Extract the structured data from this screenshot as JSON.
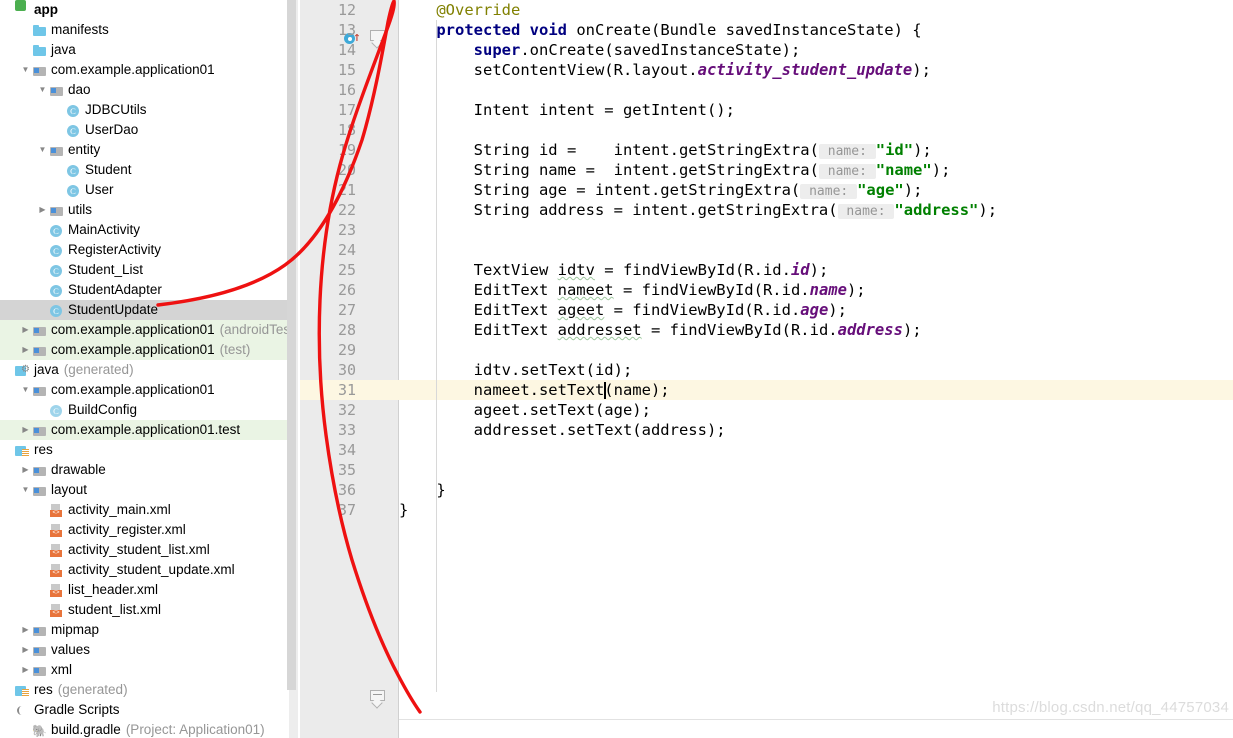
{
  "project_tree": {
    "title": "app",
    "items": [
      {
        "label": "app",
        "indent": 0,
        "arrow": "",
        "icon": "module-app-icon",
        "bold": true,
        "suffix": "",
        "state": "normal"
      },
      {
        "label": "manifests",
        "indent": 1,
        "arrow": "",
        "icon": "folder-icon",
        "suffix": "",
        "state": "normal"
      },
      {
        "label": "java",
        "indent": 1,
        "arrow": "",
        "icon": "folder-icon",
        "suffix": "",
        "state": "normal"
      },
      {
        "label": "com.example.application01",
        "indent": 1,
        "arrow": "down",
        "icon": "package-icon",
        "suffix": "",
        "state": "normal"
      },
      {
        "label": "dao",
        "indent": 2,
        "arrow": "down",
        "icon": "package-icon",
        "suffix": "",
        "state": "normal"
      },
      {
        "label": "JDBCUtils",
        "indent": 3,
        "arrow": "",
        "icon": "java-class-icon",
        "suffix": "",
        "state": "normal"
      },
      {
        "label": "UserDao",
        "indent": 3,
        "arrow": "",
        "icon": "java-class-icon",
        "suffix": "",
        "state": "normal"
      },
      {
        "label": "entity",
        "indent": 2,
        "arrow": "down",
        "icon": "package-icon",
        "suffix": "",
        "state": "normal"
      },
      {
        "label": "Student",
        "indent": 3,
        "arrow": "",
        "icon": "java-class-icon",
        "suffix": "",
        "state": "normal"
      },
      {
        "label": "User",
        "indent": 3,
        "arrow": "",
        "icon": "java-class-icon",
        "suffix": "",
        "state": "normal"
      },
      {
        "label": "utils",
        "indent": 2,
        "arrow": "right",
        "icon": "package-icon",
        "suffix": "",
        "state": "normal"
      },
      {
        "label": "MainActivity",
        "indent": 2,
        "arrow": "",
        "icon": "java-class-icon",
        "suffix": "",
        "state": "normal"
      },
      {
        "label": "RegisterActivity",
        "indent": 2,
        "arrow": "",
        "icon": "java-class-icon",
        "suffix": "",
        "state": "normal"
      },
      {
        "label": "Student_List",
        "indent": 2,
        "arrow": "",
        "icon": "java-class-icon",
        "suffix": "",
        "state": "normal"
      },
      {
        "label": "StudentAdapter",
        "indent": 2,
        "arrow": "",
        "icon": "java-class-icon",
        "suffix": "",
        "state": "normal"
      },
      {
        "label": "StudentUpdate",
        "indent": 2,
        "arrow": "",
        "icon": "java-class-icon",
        "suffix": "",
        "state": "selected"
      },
      {
        "label": "com.example.application01",
        "indent": 1,
        "arrow": "right",
        "icon": "package-icon",
        "suffix": "(androidTest)",
        "state": "green"
      },
      {
        "label": "com.example.application01",
        "indent": 1,
        "arrow": "right",
        "icon": "package-icon",
        "suffix": "(test)",
        "state": "green"
      },
      {
        "label": "java",
        "indent": 0,
        "arrow": "",
        "icon": "java-generated-icon",
        "suffix": "(generated)",
        "state": "normal"
      },
      {
        "label": "com.example.application01",
        "indent": 1,
        "arrow": "down",
        "icon": "package-icon",
        "suffix": "",
        "state": "normal"
      },
      {
        "label": "BuildConfig",
        "indent": 2,
        "arrow": "",
        "icon": "java-class-generated-icon",
        "suffix": "",
        "state": "normal"
      },
      {
        "label": "com.example.application01.test",
        "indent": 1,
        "arrow": "right",
        "icon": "package-icon",
        "suffix": "",
        "state": "green"
      },
      {
        "label": "res",
        "indent": 0,
        "arrow": "",
        "icon": "res-folder-icon",
        "suffix": "",
        "state": "normal"
      },
      {
        "label": "drawable",
        "indent": 1,
        "arrow": "right",
        "icon": "package-icon",
        "suffix": "",
        "state": "normal"
      },
      {
        "label": "layout",
        "indent": 1,
        "arrow": "down",
        "icon": "package-icon",
        "suffix": "",
        "state": "normal"
      },
      {
        "label": "activity_main.xml",
        "indent": 2,
        "arrow": "",
        "icon": "xml-layout-icon",
        "suffix": "",
        "state": "normal"
      },
      {
        "label": "activity_register.xml",
        "indent": 2,
        "arrow": "",
        "icon": "xml-layout-icon",
        "suffix": "",
        "state": "normal"
      },
      {
        "label": "activity_student_list.xml",
        "indent": 2,
        "arrow": "",
        "icon": "xml-layout-icon",
        "suffix": "",
        "state": "normal"
      },
      {
        "label": "activity_student_update.xml",
        "indent": 2,
        "arrow": "",
        "icon": "xml-layout-icon",
        "suffix": "",
        "state": "normal"
      },
      {
        "label": "list_header.xml",
        "indent": 2,
        "arrow": "",
        "icon": "xml-layout-icon",
        "suffix": "",
        "state": "normal"
      },
      {
        "label": "student_list.xml",
        "indent": 2,
        "arrow": "",
        "icon": "xml-layout-icon",
        "suffix": "",
        "state": "normal"
      },
      {
        "label": "mipmap",
        "indent": 1,
        "arrow": "right",
        "icon": "package-icon",
        "suffix": "",
        "state": "normal"
      },
      {
        "label": "values",
        "indent": 1,
        "arrow": "right",
        "icon": "package-icon",
        "suffix": "",
        "state": "normal"
      },
      {
        "label": "xml",
        "indent": 1,
        "arrow": "right",
        "icon": "package-icon",
        "suffix": "",
        "state": "normal"
      },
      {
        "label": "res",
        "indent": 0,
        "arrow": "",
        "icon": "res-folder-icon",
        "suffix": "(generated)",
        "state": "normal"
      },
      {
        "label": "Gradle Scripts",
        "indent": 0,
        "arrow": "",
        "icon": "gradle-scripts-icon",
        "suffix": "",
        "state": "normal"
      },
      {
        "label": "build.gradle",
        "indent": 1,
        "arrow": "",
        "icon": "gradle-file-icon",
        "suffix": "(Project: Application01)",
        "state": "normal"
      }
    ]
  },
  "editor": {
    "first_line_number": 12,
    "highlighted_line": 31,
    "override_marker_line": 13,
    "lines": [
      {
        "n": 12,
        "tokens": [
          {
            "t": "    ",
            "c": ""
          },
          {
            "t": "@Override",
            "c": "anno"
          }
        ]
      },
      {
        "n": 13,
        "tokens": [
          {
            "t": "    ",
            "c": ""
          },
          {
            "t": "protected",
            "c": "kw"
          },
          {
            "t": " ",
            "c": ""
          },
          {
            "t": "void",
            "c": "kw"
          },
          {
            "t": " onCreate(Bundle savedInstanceState) {",
            "c": ""
          }
        ]
      },
      {
        "n": 14,
        "tokens": [
          {
            "t": "        ",
            "c": ""
          },
          {
            "t": "super",
            "c": "kw"
          },
          {
            "t": ".onCreate(savedInstanceState);",
            "c": ""
          }
        ]
      },
      {
        "n": 15,
        "tokens": [
          {
            "t": "        setContentView(R.layout.",
            "c": ""
          },
          {
            "t": "activity_student_update",
            "c": "field"
          },
          {
            "t": ");",
            "c": ""
          }
        ]
      },
      {
        "n": 16,
        "tokens": []
      },
      {
        "n": 17,
        "tokens": [
          {
            "t": "        Intent intent = getIntent();",
            "c": ""
          }
        ]
      },
      {
        "n": 18,
        "tokens": []
      },
      {
        "n": 19,
        "tokens": [
          {
            "t": "        String id =    intent.getStringExtra(",
            "c": ""
          },
          {
            "t": " name: ",
            "c": "hint"
          },
          {
            "t": "\"id\"",
            "c": "str"
          },
          {
            "t": ");",
            "c": ""
          }
        ]
      },
      {
        "n": 20,
        "tokens": [
          {
            "t": "        String name =  intent.getStringExtra(",
            "c": ""
          },
          {
            "t": " name: ",
            "c": "hint"
          },
          {
            "t": "\"name\"",
            "c": "str"
          },
          {
            "t": ");",
            "c": ""
          }
        ]
      },
      {
        "n": 21,
        "tokens": [
          {
            "t": "        String age = intent.getStringExtra(",
            "c": ""
          },
          {
            "t": " name: ",
            "c": "hint"
          },
          {
            "t": "\"age\"",
            "c": "str"
          },
          {
            "t": ");",
            "c": ""
          }
        ]
      },
      {
        "n": 22,
        "tokens": [
          {
            "t": "        String address = intent.getStringExtra(",
            "c": ""
          },
          {
            "t": " name: ",
            "c": "hint"
          },
          {
            "t": "\"address\"",
            "c": "str"
          },
          {
            "t": ");",
            "c": ""
          }
        ]
      },
      {
        "n": 23,
        "tokens": []
      },
      {
        "n": 24,
        "tokens": []
      },
      {
        "n": 25,
        "tokens": [
          {
            "t": "        TextView ",
            "c": ""
          },
          {
            "t": "idtv",
            "c": "wavy"
          },
          {
            "t": " = findViewById(R.id.",
            "c": ""
          },
          {
            "t": "id",
            "c": "field"
          },
          {
            "t": ");",
            "c": ""
          }
        ]
      },
      {
        "n": 26,
        "tokens": [
          {
            "t": "        EditText ",
            "c": ""
          },
          {
            "t": "nameet",
            "c": "wavy"
          },
          {
            "t": " = findViewById(R.id.",
            "c": ""
          },
          {
            "t": "name",
            "c": "field"
          },
          {
            "t": ");",
            "c": ""
          }
        ]
      },
      {
        "n": 27,
        "tokens": [
          {
            "t": "        EditText ",
            "c": ""
          },
          {
            "t": "ageet",
            "c": "wavy"
          },
          {
            "t": " = findViewById(R.id.",
            "c": ""
          },
          {
            "t": "age",
            "c": "field"
          },
          {
            "t": ");",
            "c": ""
          }
        ]
      },
      {
        "n": 28,
        "tokens": [
          {
            "t": "        EditText ",
            "c": ""
          },
          {
            "t": "addresset",
            "c": "wavy"
          },
          {
            "t": " = findViewById(R.id.",
            "c": ""
          },
          {
            "t": "address",
            "c": "field"
          },
          {
            "t": ");",
            "c": ""
          }
        ]
      },
      {
        "n": 29,
        "tokens": []
      },
      {
        "n": 30,
        "tokens": [
          {
            "t": "        idtv.setText(id);",
            "c": ""
          }
        ]
      },
      {
        "n": 31,
        "tokens": [
          {
            "t": "        nameet.setText(name);",
            "c": ""
          }
        ]
      },
      {
        "n": 32,
        "tokens": [
          {
            "t": "        ageet.setText(age);",
            "c": ""
          }
        ]
      },
      {
        "n": 33,
        "tokens": [
          {
            "t": "        addresset.setText(address);",
            "c": ""
          }
        ]
      },
      {
        "n": 34,
        "tokens": []
      },
      {
        "n": 35,
        "tokens": []
      },
      {
        "n": 36,
        "tokens": [
          {
            "t": "    }",
            "c": ""
          }
        ]
      },
      {
        "n": 37,
        "tokens": [
          {
            "t": "}",
            "c": ""
          }
        ]
      }
    ]
  },
  "watermark": {
    "text": "https://blog.csdn.net/qq_44757034"
  },
  "annotation": {
    "color": "#ee1111",
    "shape": "hand-drawn-loop-arrow"
  },
  "colors": {
    "keyword": "#000080",
    "string": "#008000",
    "annotation_token": "#808000",
    "static_field": "#660e7a",
    "param_hint_bg": "#ededed",
    "selected_row": "#d4d4d4",
    "test_row": "#eaf4e4",
    "current_line": "#fdf7e2",
    "gutter_bg": "#ebebeb"
  }
}
